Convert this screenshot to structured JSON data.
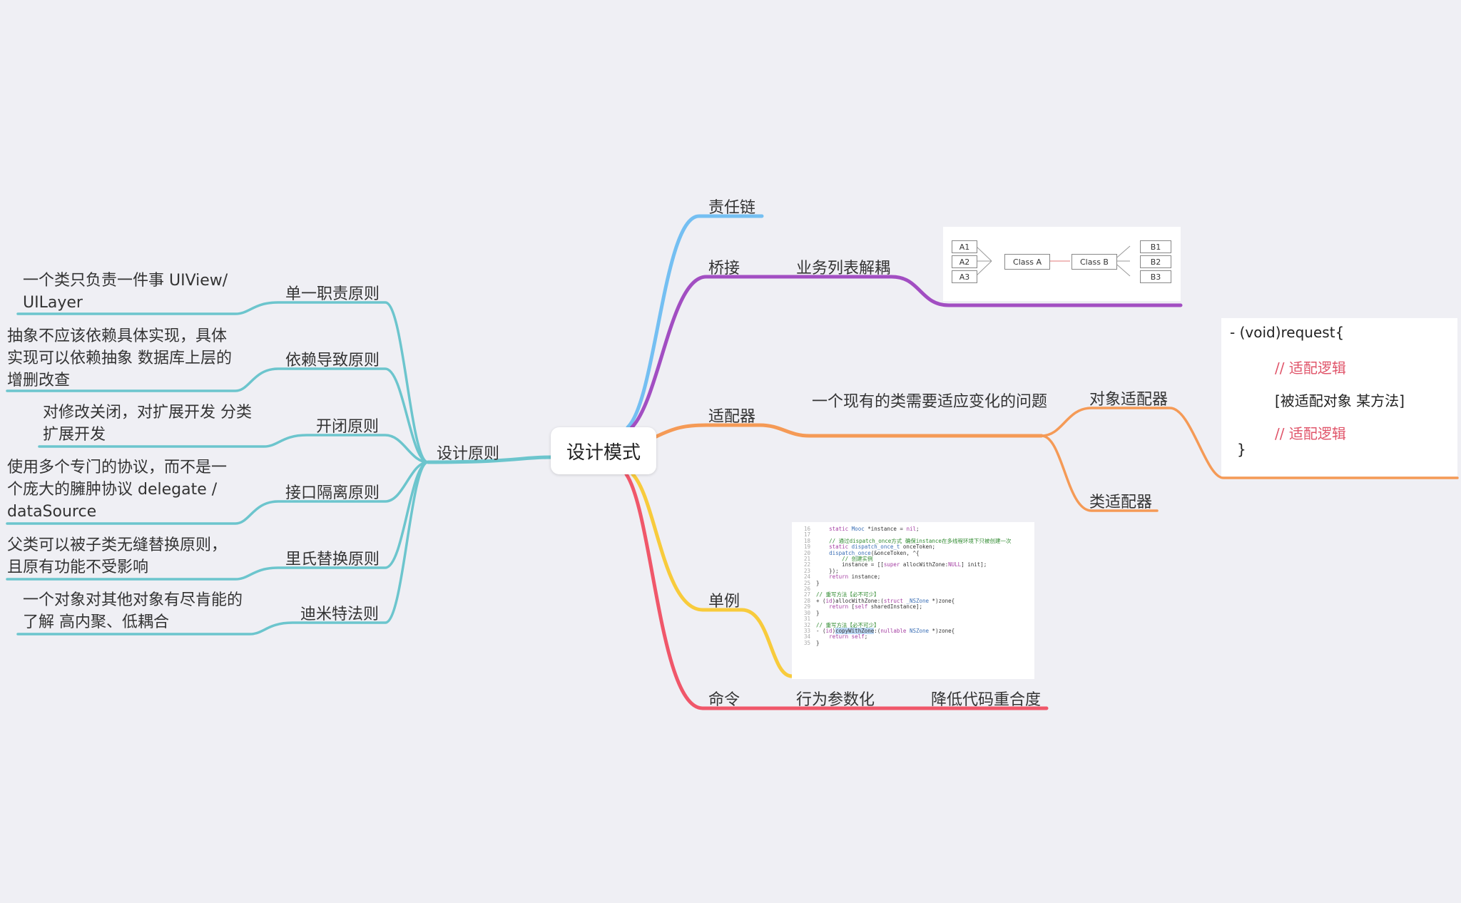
{
  "root": "设计模式",
  "colors": {
    "teal": "#6cc5cd",
    "blue": "#74bff2",
    "purple": "#a24ec2",
    "orange": "#f59a56",
    "yellow": "#f8cb3c",
    "red": "#f0576a"
  },
  "left": {
    "branch": "设计原则",
    "principles": [
      {
        "name": "单一职责原则",
        "desc": "一个类只负责一件事 UIView/ UILayer"
      },
      {
        "name": "依赖导致原则",
        "desc": "抽象不应该依赖具体实现，具体实现可以依赖抽象   数据库上层的增删改查"
      },
      {
        "name": "开闭原则",
        "desc": "对修改关闭，对扩展开发 分类扩展开发"
      },
      {
        "name": "接口隔离原则",
        "desc": "使用多个专门的协议，而不是一个庞大的臃肿协议  delegate / dataSource"
      },
      {
        "name": "里氏替换原则",
        "desc": "父类可以被子类无缝替换原则，且原有功能不受影响"
      },
      {
        "name": "迪米特法则",
        "desc": "一个对象对其他对象有尽肯能的了解 高内聚、低耦合"
      }
    ]
  },
  "right": {
    "chain": "责任链",
    "bridge": "桥接",
    "bridge_child": "业务列表解耦",
    "bridge_diagram": {
      "left": [
        "A1",
        "A2",
        "A3"
      ],
      "class_a": "Class A",
      "class_b": "Class B",
      "right": [
        "B1",
        "B2",
        "B3"
      ]
    },
    "adapter": "适配器",
    "adapter_child": "一个现有的类需要适应变化的问题",
    "object_adapter": "对象适配器",
    "class_adapter": "类适配器",
    "adapter_code": {
      "line1": "- (void)request{",
      "comment": "// 适配逻辑",
      "call": "[被适配对象  某方法]",
      "close": "}"
    },
    "singleton": "单例",
    "command": "命令",
    "command_child1": "行为参数化",
    "command_child2": "降低代码重合度"
  },
  "singleton_code": [
    {
      "n": "16",
      "html": "    <span class='k'>static</span> <span class='t'>Mooc</span> *instance = <span class='k'>nil</span>;"
    },
    {
      "n": "17",
      "html": ""
    },
    {
      "n": "18",
      "html": "    <span class='c'>// 通过dispatch_once方式 确保instance在多线程环境下只被创建一次</span>"
    },
    {
      "n": "19",
      "html": "    <span class='k'>static</span> <span class='t'>dispatch_once_t</span> onceToken;"
    },
    {
      "n": "20",
      "html": "    <span class='t'>dispatch_once</span>(&amp;onceToken, ^{"
    },
    {
      "n": "21",
      "html": "        <span class='c'>// 创建实例</span>"
    },
    {
      "n": "22",
      "html": "        instance = [[<span class='k'>super</span> allocWithZone:<span class='k'>NULL</span>] init];"
    },
    {
      "n": "23",
      "html": "    });"
    },
    {
      "n": "24",
      "html": "    <span class='k'>return</span> instance;"
    },
    {
      "n": "25",
      "html": "}"
    },
    {
      "n": "26",
      "html": ""
    },
    {
      "n": "27",
      "html": "<span class='c'>// 重写方法【必不可少】</span>"
    },
    {
      "n": "28",
      "html": "+ (<span class='k'>id</span>)allocWithZone:(<span class='k'>struct</span> <span class='t'>_NSZone</span> *)zone{"
    },
    {
      "n": "29",
      "html": "    <span class='k'>return</span> [<span class='k'>self</span> sharedInstance];"
    },
    {
      "n": "30",
      "html": "}"
    },
    {
      "n": "31",
      "html": ""
    },
    {
      "n": "32",
      "html": "<span class='c'>// 重写方法【必不可少】</span>"
    },
    {
      "n": "33",
      "html": "- (<span class='k'>id</span>)<span class='h'>copyWithZone</span>:(<span class='k'>nullable</span> <span class='t'>NSZone</span> *)zone{"
    },
    {
      "n": "34",
      "html": "    <span class='k'>return</span> <span class='k'>self</span>;"
    },
    {
      "n": "35",
      "html": "}"
    }
  ]
}
